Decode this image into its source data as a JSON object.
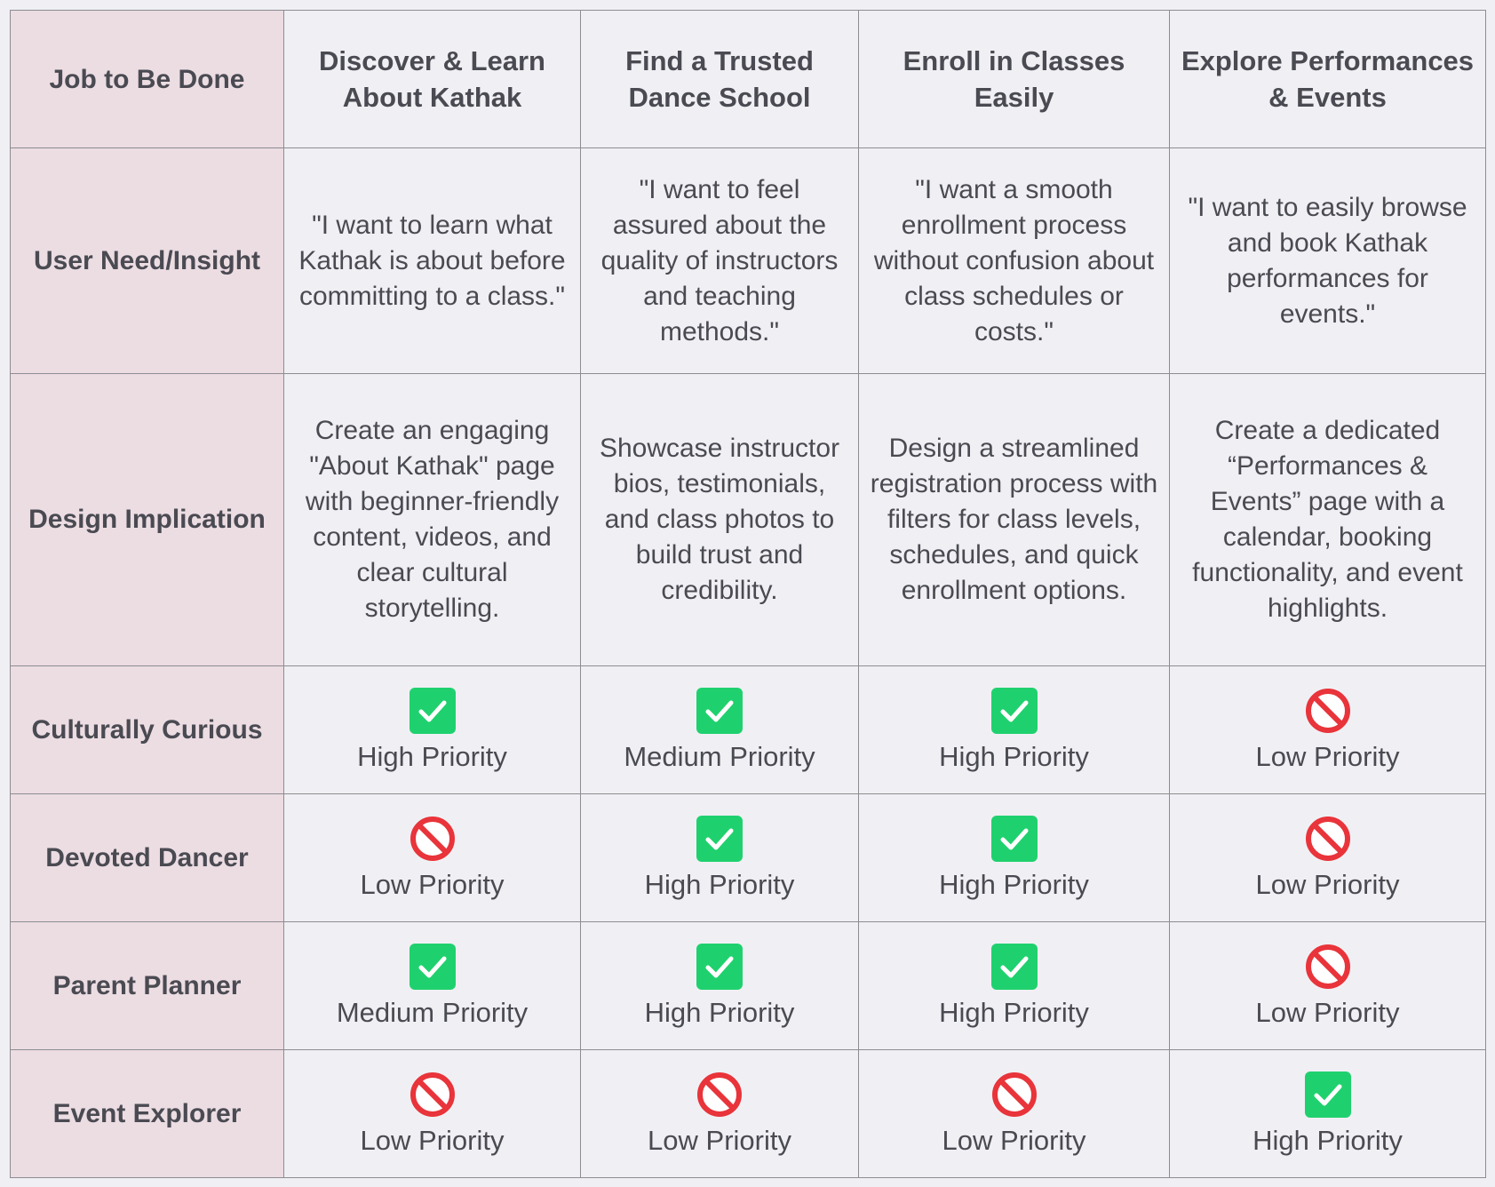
{
  "header": {
    "corner": "Job to Be Done",
    "jobs": [
      "Discover & Learn About Kathak",
      "Find a Trusted Dance School",
      "Enroll in Classes Easily",
      "Explore Performances & Events"
    ]
  },
  "rows": {
    "need": {
      "label": "User Need/Insight",
      "cells": [
        "\"I want to learn what Kathak is about before committing to a class.\"",
        "\"I want to feel assured about the quality of instructors and teaching methods.\"",
        "\"I want a smooth enrollment process without confusion about class schedules or costs.\"",
        "\"I want to easily browse and book Kathak performances for events.\""
      ]
    },
    "implication": {
      "label": "Design Implication",
      "cells": [
        "Create an engaging \"About Kathak\" page with beginner-friendly content, videos, and clear cultural storytelling.",
        "Showcase instructor bios, testimonials, and class photos to build trust and credibility.",
        "Design a streamlined registration process with filters for class levels, schedules, and quick enrollment options.",
        "Create a dedicated “Performances & Events” page with a calendar, booking functionality, and event highlights."
      ]
    }
  },
  "personas": [
    {
      "label": "Culturally Curious",
      "cells": [
        {
          "icon": "check-icon",
          "text": "High Priority"
        },
        {
          "icon": "check-icon",
          "text": "Medium Priority"
        },
        {
          "icon": "check-icon",
          "text": "High Priority"
        },
        {
          "icon": "prohibited-icon",
          "text": "Low Priority"
        }
      ]
    },
    {
      "label": "Devoted Dancer",
      "cells": [
        {
          "icon": "prohibited-icon",
          "text": "Low Priority"
        },
        {
          "icon": "check-icon",
          "text": "High Priority"
        },
        {
          "icon": "check-icon",
          "text": "High Priority"
        },
        {
          "icon": "prohibited-icon",
          "text": "Low Priority"
        }
      ]
    },
    {
      "label": "Parent Planner",
      "cells": [
        {
          "icon": "check-icon",
          "text": "Medium Priority"
        },
        {
          "icon": "check-icon",
          "text": "High Priority"
        },
        {
          "icon": "check-icon",
          "text": "High Priority"
        },
        {
          "icon": "prohibited-icon",
          "text": "Low Priority"
        }
      ]
    },
    {
      "label": "Event Explorer",
      "cells": [
        {
          "icon": "prohibited-icon",
          "text": "Low Priority"
        },
        {
          "icon": "prohibited-icon",
          "text": "Low Priority"
        },
        {
          "icon": "prohibited-icon",
          "text": "Low Priority"
        },
        {
          "icon": "check-icon",
          "text": "High Priority"
        }
      ]
    }
  ],
  "colors": {
    "check": "#1fd16e",
    "prohibited": "#e8343a",
    "label_bg": "#ecdde3",
    "cell_bg": "#f0f0f4",
    "text": "#4a4a52"
  }
}
